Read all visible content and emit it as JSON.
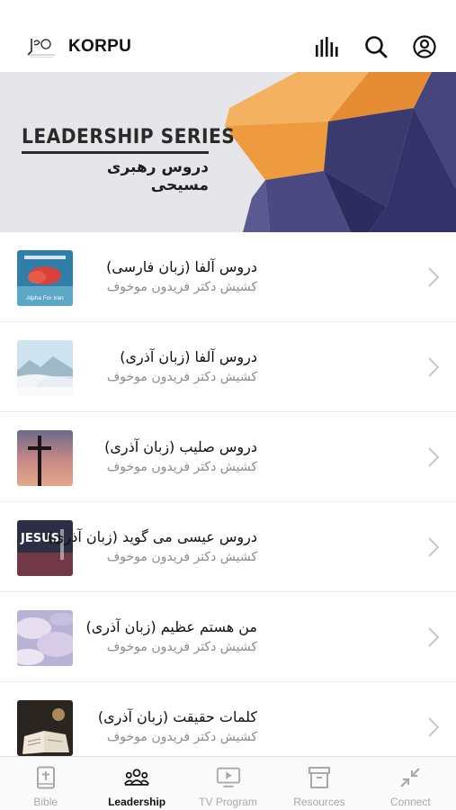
{
  "header": {
    "title": "KORPU",
    "icons": [
      "logo",
      "audio-bars-icon",
      "search-icon",
      "profile-icon"
    ]
  },
  "banner": {
    "title": "LEADERSHIP SERIES",
    "subtitle": "دروس رهبری مسیحی",
    "colors": {
      "orange": "#f0a046",
      "navy": "#3b3a6e",
      "dark_navy": "#2e2c5e"
    }
  },
  "list": {
    "items": [
      {
        "title": "دروس آلفا (زبان فارسی)",
        "subtitle": "کشیش دکتر فریدون موخوف",
        "thumbnail_text": "Alpha For Iran",
        "thumbnail_icon": "alpha-red-clouds-icon"
      },
      {
        "title": "دروس آلفا (زبان آذری)",
        "subtitle": "کشیش دکتر فریدون موخوف",
        "thumbnail_icon": "mountain-clouds-icon"
      },
      {
        "title": "دروس صلیب (زبان آذری)",
        "subtitle": "کشیش دکتر فریدون موخوف",
        "thumbnail_icon": "cross-sunset-icon"
      },
      {
        "title": "دروس عیسی می گوید (زبان آذری)",
        "subtitle": "کشیش دکتر فریدون موخوف",
        "thumbnail_text": "JESUS",
        "thumbnail_icon": "jesus-text-icon"
      },
      {
        "title": "من هستم عظیم (زبان آذری)",
        "subtitle": "کشیش دکتر فریدون موخوف",
        "thumbnail_icon": "pastel-sky-icon"
      },
      {
        "title": "کلمات حقیقت (زبان آذری)",
        "subtitle": "کشیش دکتر فریدون موخوف",
        "thumbnail_icon": "open-bible-icon"
      }
    ]
  },
  "tabs": [
    {
      "label": "Bible",
      "icon": "bible-icon",
      "active": false
    },
    {
      "label": "Leadership",
      "icon": "people-group-icon",
      "active": true
    },
    {
      "label": "TV Program",
      "icon": "tv-play-icon",
      "active": false
    },
    {
      "label": "Resources",
      "icon": "archive-box-icon",
      "active": false
    },
    {
      "label": "Connect",
      "icon": "arrows-inward-icon",
      "active": false
    }
  ],
  "colors": {
    "active_tab": "#111111",
    "inactive_tab": "#a9a9a9",
    "subtitle": "#8c8c8c"
  }
}
